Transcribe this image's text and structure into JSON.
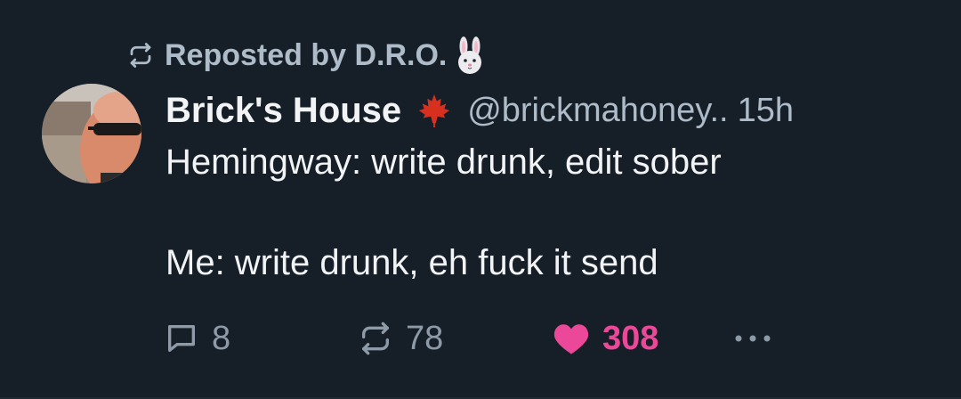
{
  "repost": {
    "prefix": "Reposted by D.R.O.",
    "emoji_icon": "rabbit-face-icon"
  },
  "author": {
    "display_name": "Brick's House",
    "flag_icon": "maple-leaf-icon",
    "handle": "@brickmahoney..",
    "timestamp": "15h"
  },
  "post": {
    "line1": "Hemingway: write drunk, edit sober",
    "line2": "Me: write drunk, eh fuck it send"
  },
  "actions": {
    "reply_count": "8",
    "repost_count": "78",
    "like_count": "308",
    "like_color": "#ec4899"
  },
  "colors": {
    "background": "#161e27",
    "primary_text": "#f1f3f5",
    "secondary_text": "#aebbc9"
  }
}
